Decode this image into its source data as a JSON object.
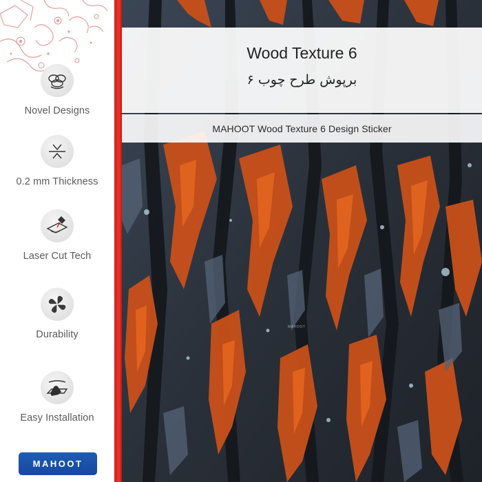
{
  "product": {
    "title_en": "Wood Texture 6",
    "title_fa": "برپوش طرح چوب ۶",
    "subtitle": "MAHOOT Wood Texture 6 Design Sticker"
  },
  "features": [
    {
      "label": "Novel Designs",
      "icon": "petal-cluster-icon"
    },
    {
      "label": "0.2 mm Thickness",
      "icon": "thickness-arrows-icon"
    },
    {
      "label": "Laser Cut  Tech",
      "icon": "laser-cut-icon"
    },
    {
      "label": "Durability",
      "icon": "clover-shield-icon"
    },
    {
      "label": "Easy Installation",
      "icon": "hand-apply-icon"
    }
  ],
  "brand": {
    "logo_text": "MAHOOT",
    "watermark": "MAHOOT",
    "colors": {
      "accent_red": "#d41c1c",
      "logo_blue": "#1a4fa8",
      "texture_orange": "#d2561c",
      "texture_slate": "#3c4758"
    }
  }
}
